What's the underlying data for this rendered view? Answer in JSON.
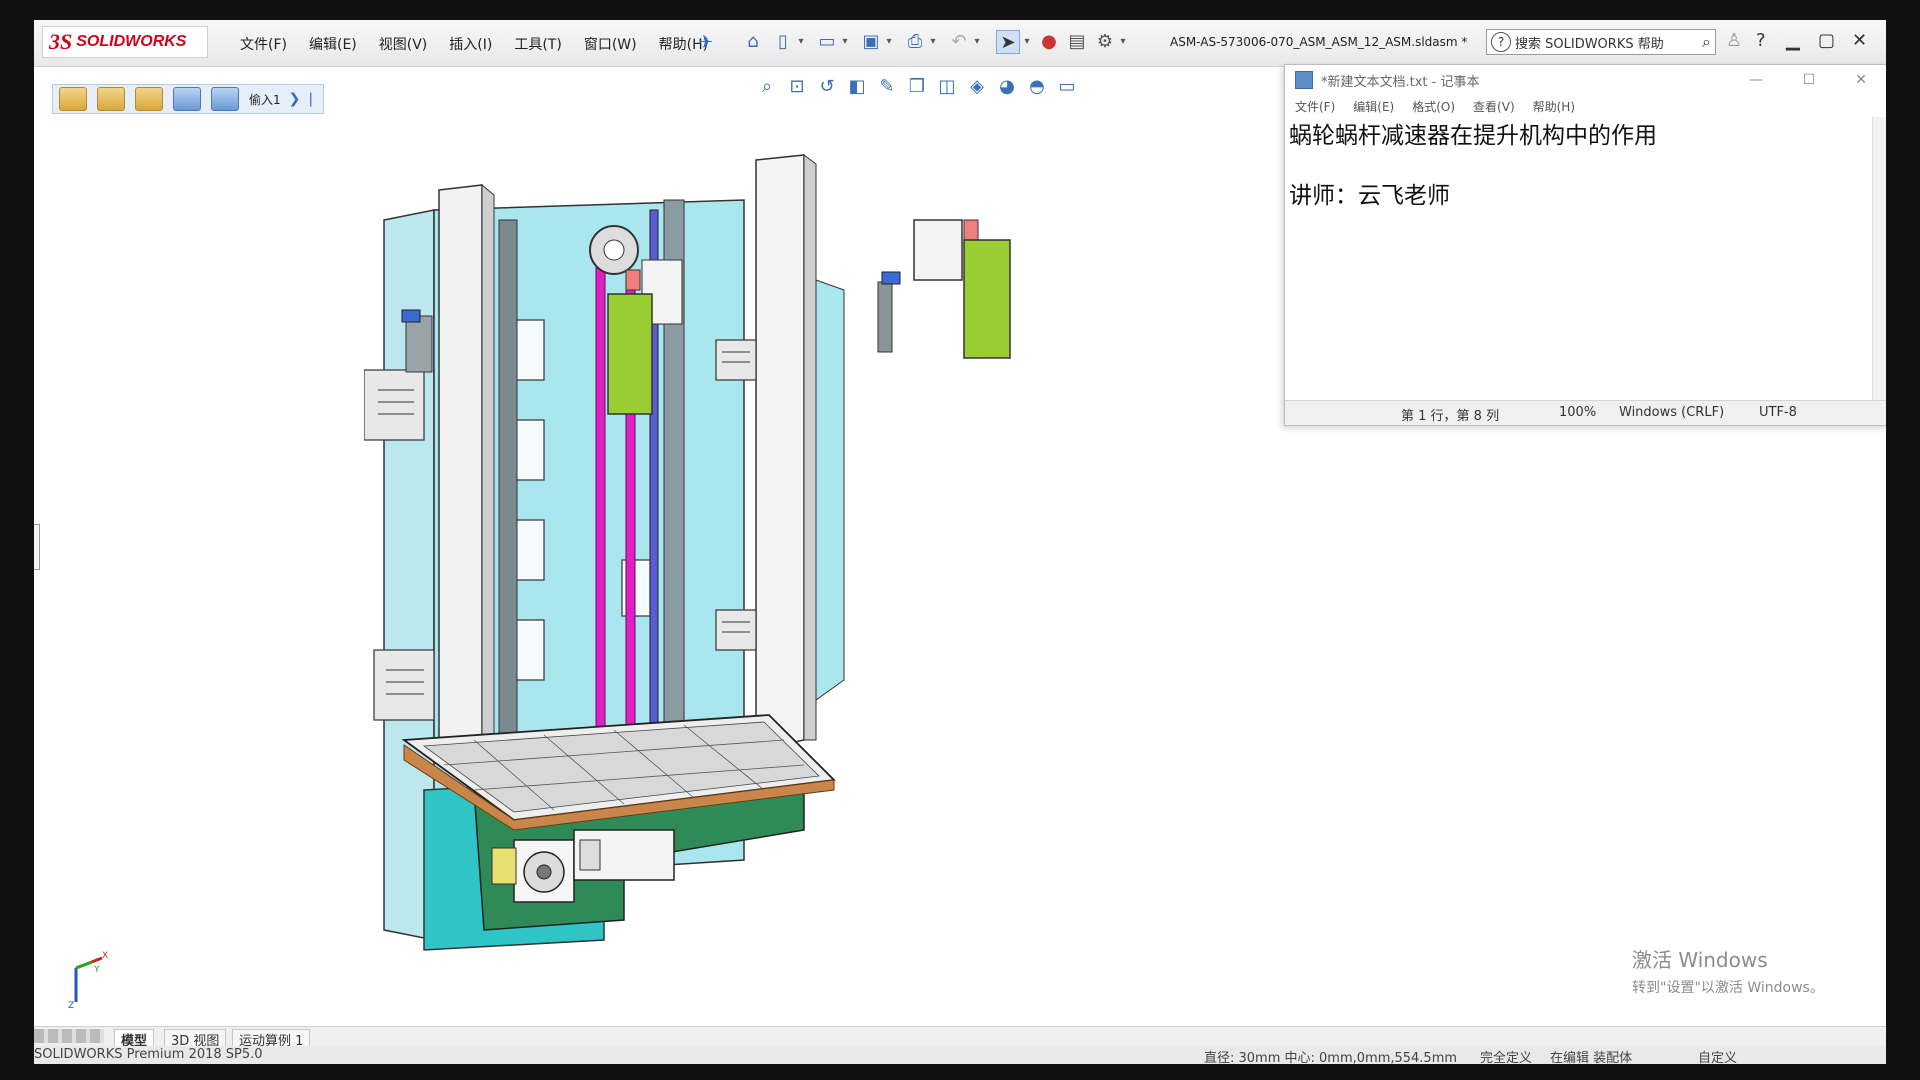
{
  "app": {
    "logo_mark": "3S",
    "logo_text": "SOLIDWORKS",
    "menu": [
      "文件(F)",
      "编辑(E)",
      "视图(V)",
      "插入(I)",
      "工具(T)",
      "窗口(W)",
      "帮助(H)"
    ],
    "document_title": "ASM-AS-573006-070_ASM_ASM_12_ASM.sldasm *",
    "help_search_placeholder": "搜索 SOLIDWORKS 帮助",
    "breadcrumb_label": "偷入1"
  },
  "notepad": {
    "title": "*新建文本文档.txt - 记事本",
    "menu": [
      "文件(F)",
      "编辑(E)",
      "格式(O)",
      "查看(V)",
      "帮助(H)"
    ],
    "content": "蜗轮蜗杆减速器在提升机构中的作用\n\n讲师：云飞老师",
    "status": {
      "position": "第 1 行，第 8 列",
      "zoom": "100%",
      "line_ending": "Windows (CRLF)",
      "encoding": "UTF-8"
    }
  },
  "tabs": [
    "模型",
    "3D 视图",
    "运动算例 1"
  ],
  "status_bar": {
    "product": "SOLIDWORKS Premium 2018 SP5.0",
    "measure": "直径: 30mm  中心: 0mm,0mm,554.5mm",
    "state": "完全定义",
    "mode": "在编辑 装配体",
    "units": "自定义"
  },
  "watermark": {
    "line1": "激活 Windows",
    "line2": "转到\"设置\"以激活 Windows。"
  },
  "axis_labels": {
    "x": "X",
    "y": "Y",
    "z": "Z"
  },
  "colors": {
    "brand": "#d0021b",
    "accent": "#2a6ad3",
    "frame_cyan": "#a9e6ee",
    "belt_magenta": "#e01fc4",
    "block_green": "#9acd32",
    "base_teal": "#2fc4c6"
  }
}
